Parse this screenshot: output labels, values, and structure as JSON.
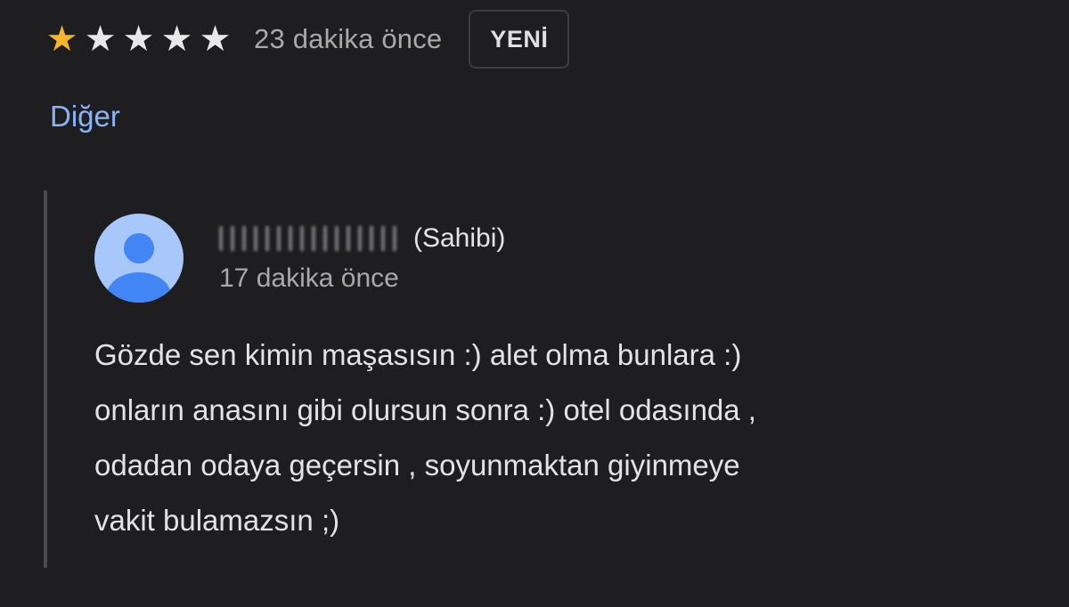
{
  "review": {
    "rating": 1,
    "rating_max": 5,
    "star_color": "#f6b42c",
    "time_ago": "23 dakika önce",
    "new_badge": "YENİ",
    "more_link": "Diğer"
  },
  "reply": {
    "owner_tag": "(Sahibi)",
    "time_ago": "17 dakika önce",
    "lines": [
      "Gözde sen kimin maşasısın :) alet olma bunlara :)",
      "onların anasını gibi olursun sonra :) otel odasında ,",
      "odadan odaya geçersin , soyunmaktan giyinmeye",
      "vakit bulamazsın ;)"
    ],
    "avatar_icon": "person-icon"
  },
  "colors": {
    "background": "#1e1e21",
    "link": "#8ab4f8",
    "avatar_bg": "#a8c7fa",
    "avatar_fg": "#4285f4"
  }
}
